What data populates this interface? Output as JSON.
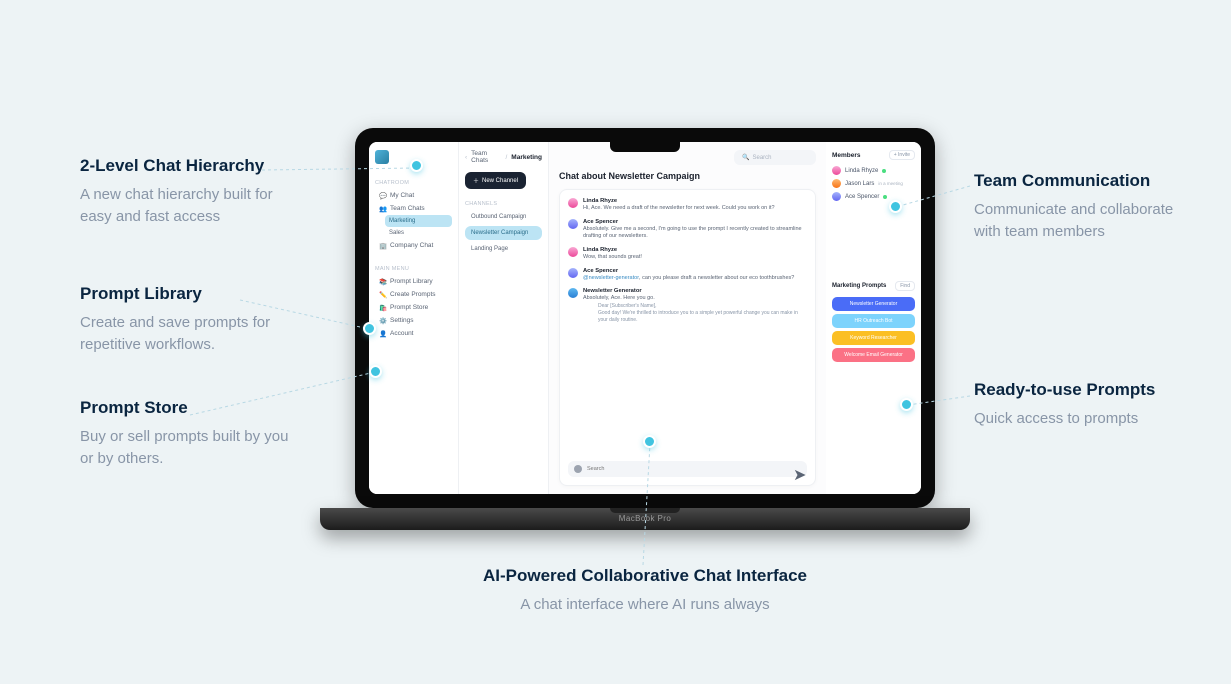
{
  "annotations": {
    "hierarchy": {
      "title": "2-Level Chat Hierarchy",
      "desc": "A new chat hierarchy built for easy and fast access"
    },
    "promptLibrary": {
      "title": "Prompt Library",
      "desc": "Create and save prompts for repetitive workflows."
    },
    "promptStore": {
      "title": "Prompt Store",
      "desc": "Buy or sell prompts built by you or by others."
    },
    "teamComm": {
      "title": "Team Communication",
      "desc": "Communicate and collaborate with team members"
    },
    "readyPrompts": {
      "title": "Ready-to-use Prompts",
      "desc": "Quick access to prompts"
    },
    "aiChat": {
      "title": "AI-Powered Collaborative Chat Interface",
      "desc": "A chat interface where AI runs always"
    }
  },
  "laptop": {
    "label": "MacBook Pro"
  },
  "sidebar": {
    "sectionChatroom": "Chatroom",
    "myChat": "My Chat",
    "teamChats": "Team Chats",
    "marketing": "Marketing",
    "sales": "Sales",
    "companyChat": "Company Chat",
    "sectionMainMenu": "Main Menu",
    "promptLibrary": "Prompt Library",
    "createPrompts": "Create Prompts",
    "promptStore": "Prompt Store",
    "settings": "Settings",
    "account": "Account"
  },
  "channels": {
    "breadcrumb1": "Team Chats",
    "breadcrumb2": "Marketing",
    "newChannel": "New Channel",
    "sectionLabel": "Channels",
    "outbound": "Outbound Campaign",
    "newsletter": "Newsletter Campaign",
    "landing": "Landing Page"
  },
  "main": {
    "searchPlaceholder": "Search",
    "chatTitle": "Chat about Newsletter Campaign",
    "messages": {
      "m1": {
        "name": "Linda Rhyze",
        "text": "Hi, Ace. We need a draft of the newsletter for next week. Could you work on it?"
      },
      "m2": {
        "name": "Ace Spencer",
        "text": "Absolutely. Give me a second, I'm going to use the prompt I recently created to streamline drafting of our newsletters."
      },
      "m3": {
        "name": "Linda Rhyze",
        "text": "Wow, that sounds great!"
      },
      "m4": {
        "name": "Ace Spencer",
        "mention": "@newsletter-generator",
        "text": ", can you please draft a newsletter about our eco toothbrushes?"
      },
      "m5": {
        "name": "Newsletter Generator",
        "line1": "Absolutely, Ace. Here you go.",
        "line2": "Dear [Subscriber's Name],",
        "line3": "Good day! We're thrilled to introduce you to a simple yet powerful change you can make in your daily routine."
      }
    }
  },
  "members": {
    "title": "Members",
    "invite": "+ Invite",
    "m1": "Linda Rhyze",
    "m2": "Jason Lars",
    "m2status": "in a meeting",
    "m3": "Ace Spencer"
  },
  "prompts": {
    "title": "Marketing Prompts",
    "find": "Find",
    "p1": "Newsletter Generator",
    "p2": "HR Outreach Bot",
    "p3": "Keyword Researcher",
    "p4": "Welcome Email Generator"
  }
}
